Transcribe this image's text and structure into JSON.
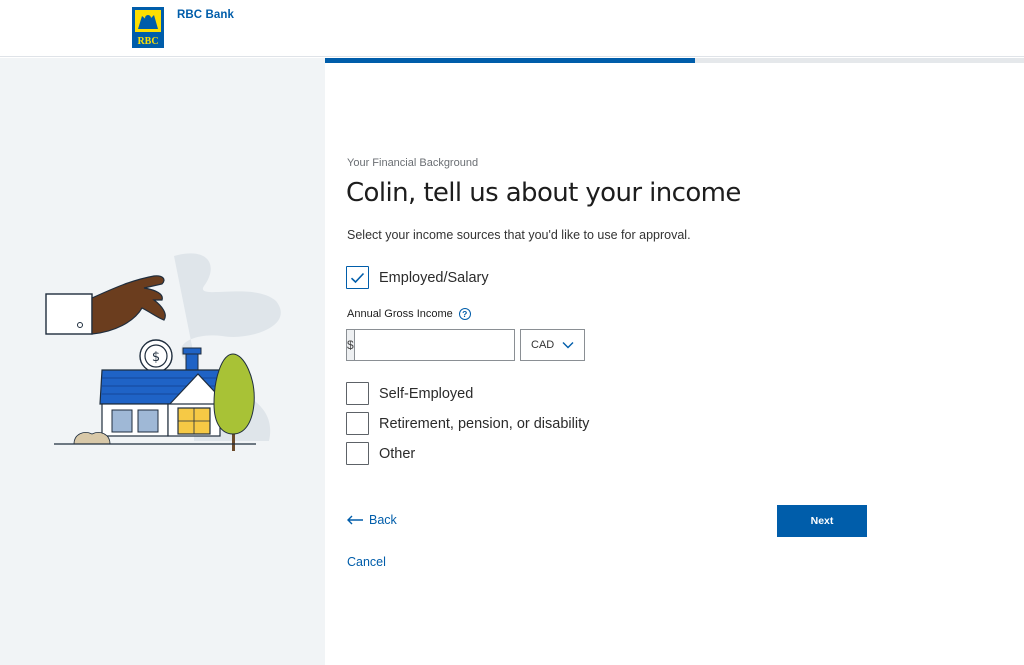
{
  "header": {
    "brand_name": "RBC Bank",
    "logo_text": "RBC"
  },
  "progress": {
    "fraction_complete": 0.53
  },
  "main": {
    "eyebrow": "Your Financial Background",
    "title": "Colin, tell us about your income",
    "instruction": "Select your income sources that you'd like to use for approval.",
    "income_sources": [
      {
        "label": "Employed/Salary",
        "checked": true
      },
      {
        "label": "Self-Employed",
        "checked": false
      },
      {
        "label": "Retirement, pension, or disability",
        "checked": false
      },
      {
        "label": "Other",
        "checked": false
      }
    ],
    "annual_income": {
      "label": "Annual Gross Income",
      "help_icon": "question-circle-icon",
      "prefix": "$",
      "value": "",
      "currency": "CAD"
    }
  },
  "actions": {
    "back_label": "Back",
    "next_label": "Next",
    "cancel_label": "Cancel"
  },
  "colors": {
    "primary": "#005daa",
    "brand_yellow": "#fedf01",
    "panel_background": "#f1f4f6"
  }
}
